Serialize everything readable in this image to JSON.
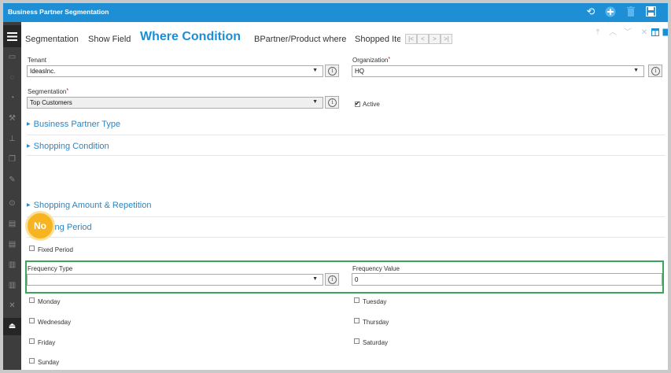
{
  "window": {
    "title": "Business Partner Segmentation"
  },
  "toolbar": {
    "icons": [
      "refresh-icon",
      "add-icon",
      "delete-icon",
      "save-icon"
    ],
    "refresh": "⟲",
    "add": "+",
    "delete": "🗑",
    "save": "💾"
  },
  "tabs": [
    {
      "label": "Segmentation"
    },
    {
      "label": "Show Field"
    },
    {
      "label": "Where Condition",
      "selected": true
    },
    {
      "label": "BPartner/Product where"
    },
    {
      "label": "Shopped Ite"
    }
  ],
  "nav": {
    "first": "|<",
    "prev": "<",
    "next": ">",
    "last": ">|"
  },
  "form": {
    "tenant_label": "Tenant",
    "tenant_value": "IdeasInc.",
    "organization_label": "Organization",
    "organization_value": "HQ",
    "segmentation_label": "Segmentation",
    "segmentation_value": "Top Customers",
    "active_label": "Active",
    "active_checked": true,
    "required_mark": "*",
    "info_glyph": "i",
    "dropdown_glyph": "▼"
  },
  "sections": [
    {
      "label": "Business Partner Type"
    },
    {
      "label": "Shopping Condition"
    },
    {
      "label": "Shopping Amount & Repetition"
    },
    {
      "label": "ping Period"
    }
  ],
  "period": {
    "fixed_period_label": "Fixed Period",
    "frequency_type_label": "Frequency Type",
    "frequency_type_value": "",
    "frequency_value_label": "Frequency Value",
    "frequency_value_value": "0"
  },
  "days": {
    "monday": "Monday",
    "tuesday": "Tuesday",
    "wednesday": "Wednesday",
    "thursday": "Thursday",
    "friday": "Friday",
    "saturday": "Saturday",
    "sunday": "Sunday"
  },
  "callout": {
    "text": "No"
  },
  "colors": {
    "accent": "#1a8fd8",
    "titlebar": "#1e8fd5",
    "highlight": "#3aa55b",
    "badge": "#f7b421"
  }
}
